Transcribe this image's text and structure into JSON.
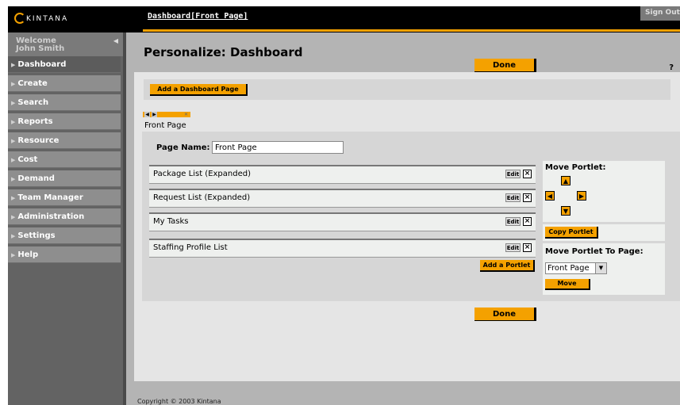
{
  "brand": {
    "name": "KINTANA"
  },
  "header": {
    "breadcrumb": "Dashboard[Front Page]",
    "sign_out": "Sign Out"
  },
  "sidebar": {
    "welcome_line1": "Welcome",
    "welcome_line2": "John Smith",
    "items": [
      {
        "label": "Dashboard",
        "active": true
      },
      {
        "label": "Create"
      },
      {
        "label": "Search"
      },
      {
        "label": "Reports"
      },
      {
        "label": "Resource"
      },
      {
        "label": "Cost"
      },
      {
        "label": "Demand"
      },
      {
        "label": "Team Manager"
      },
      {
        "label": "Administration"
      },
      {
        "label": "Settings"
      },
      {
        "label": "Help"
      }
    ]
  },
  "main": {
    "title": "Personalize: Dashboard",
    "help": "?",
    "done_label": "Done",
    "add_page_label": "Add a Dashboard Page",
    "tab_label": "Front Page",
    "page_name_label": "Page Name:",
    "page_name_value": "Front Page",
    "portlets": [
      {
        "label": "Package List (Expanded)"
      },
      {
        "label": "Request List (Expanded)"
      },
      {
        "label": "My Tasks"
      },
      {
        "label": "Staffing Profile List"
      }
    ],
    "edit_label": "Edit",
    "remove_label": "×",
    "add_portlet_label": "Add a Portlet",
    "move_portlet_title": "Move Portlet:",
    "copy_portlet_label": "Copy Portlet",
    "move_to_page_title": "Move Portlet To Page:",
    "move_to_page_selected": "Front Page",
    "move_label": "Move"
  },
  "footer": {
    "copyright": "Copyright © 2003 Kintana"
  },
  "colors": {
    "accent": "#f4a100",
    "sidebar": "#8e8e8e",
    "panel": "#d6d6d6",
    "background": "#b4b4b4"
  }
}
